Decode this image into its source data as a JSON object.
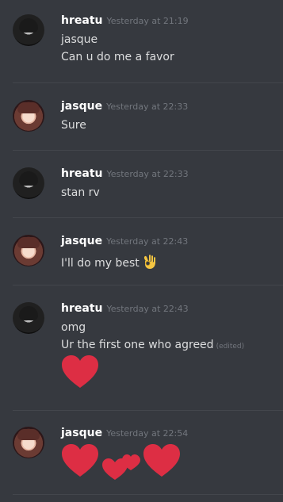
{
  "messages": [
    {
      "username": "hreatu",
      "timestamp": "Yesterday at 21:19",
      "lines": [
        "jasque",
        "Can u do me a favor"
      ]
    },
    {
      "username": "jasque",
      "timestamp": "Yesterday at 22:33",
      "lines": [
        "Sure"
      ]
    },
    {
      "username": "hreatu",
      "timestamp": "Yesterday at 22:33",
      "lines": [
        "stan rv"
      ]
    },
    {
      "username": "jasque",
      "timestamp": "Yesterday at 22:43",
      "lines": [
        "I'll do my best"
      ],
      "emoji": "ok-hand-emoji"
    },
    {
      "username": "hreatu",
      "timestamp": "Yesterday at 22:43",
      "lines": [
        "omg",
        "Ur the first one who agreed"
      ],
      "edited": "(edited)",
      "emoji": "red-heart-emoji"
    },
    {
      "username": "jasque",
      "timestamp": "Yesterday at 22:54",
      "emoji": "hearts-emoji-row"
    }
  ],
  "colors": {
    "background": "#36393f",
    "divider": "#43464c",
    "username": "#ffffff",
    "timestamp": "#72767d",
    "text": "#dcddde",
    "heart": "#dd2e44"
  }
}
